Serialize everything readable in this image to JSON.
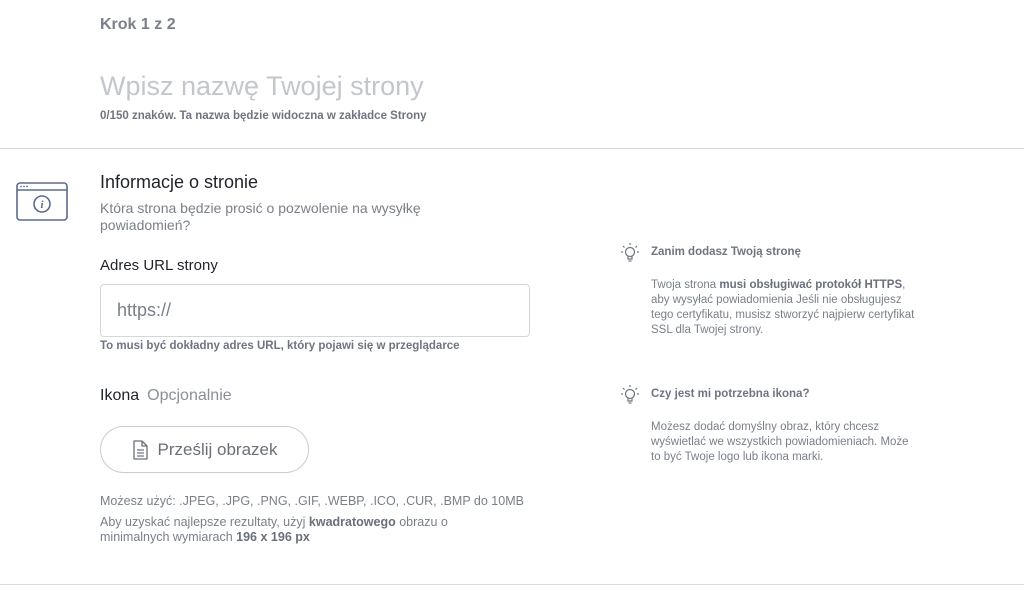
{
  "header": {
    "step": "Krok 1 z 2",
    "name_placeholder": "Wpisz nazwę Twojej strony",
    "name_help_prefix": "0/150 znaków. Ta nazwa będzie widoczna w zakładce ",
    "name_help_bold": "Strony"
  },
  "section": {
    "title": "Informacje o stronie",
    "subtitle": "Która strona będzie prosić o pozwolenie na wysyłkę powiadomień?"
  },
  "url": {
    "label": "Adres URL strony",
    "placeholder": "https://",
    "help": "To musi być dokładny adres URL, który pojawi się w przeglądarce"
  },
  "icon_field": {
    "label": "Ikona",
    "optional": "Opcjonalnie",
    "upload_label": "Prześlij obrazek",
    "formats": "Możesz użyć: .JPEG, .JPG, .PNG, .GIF, .WEBP, .ICO, .CUR, .BMP do 10MB",
    "advice_part1": "Aby uzyskać najlepsze rezultaty, użyj ",
    "advice_bold1": "kwadratowego",
    "advice_part2": " obrazu o minimalnych wymiarach ",
    "advice_bold2": "196 x 196 px"
  },
  "tips": [
    {
      "icon": "lightbulb-icon",
      "title": "Zanim dodasz Twoją stronę",
      "body_part1": "Twoja strona ",
      "body_bold": "musi obsługiwać protokół HTTPS",
      "body_part2": ", aby wysyłać powiadomienia Jeśli nie obsługujesz tego certyfikatu, musisz stworzyć najpierw certyfikat SSL dla Twojej strony."
    },
    {
      "icon": "lightbulb-icon",
      "title": "Czy jest mi potrzebna ikona?",
      "body": "Możesz dodać domyślny obraz, który chcesz wyświetlać we wszystkich powiadomieniach. Może to być Twoje logo lub ikona marki."
    }
  ],
  "icons": {
    "section_icon": "browser-info-icon",
    "upload_icon": "document-icon"
  },
  "colors": {
    "text_primary": "#1f2229",
    "text_secondary": "#7a7f89",
    "border": "#d3d6db",
    "icon_blue": "#5b6b8c"
  }
}
